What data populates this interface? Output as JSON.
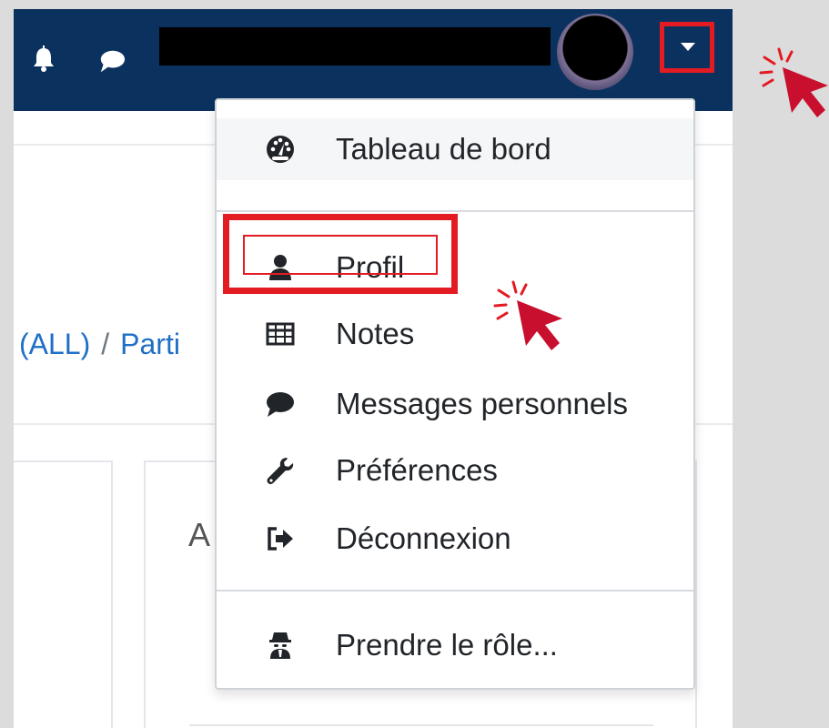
{
  "colors": {
    "navbar": "#0b325f",
    "highlight": "#e31b23",
    "link": "#1f6fc5",
    "text": "#212529"
  },
  "navbar": {
    "icons": [
      "bell-icon",
      "chat-icon"
    ],
    "user_name": "",
    "toggle_icon": "caret-down-icon"
  },
  "breadcrumb": {
    "first": "(ALL)",
    "separator": "/",
    "second": "Parti"
  },
  "block": {
    "heading": "A"
  },
  "user_menu": {
    "items": [
      {
        "label": "Tableau de bord",
        "icon": "dashboard-icon"
      },
      {
        "label": "Profil",
        "icon": "user-icon"
      },
      {
        "label": "Notes",
        "icon": "table-icon"
      },
      {
        "label": "Messages personnels",
        "icon": "comment-icon"
      },
      {
        "label": "Préférences",
        "icon": "wrench-icon"
      },
      {
        "label": "Déconnexion",
        "icon": "sign-out-icon"
      },
      {
        "label": "Prendre le rôle...",
        "icon": "user-secret-icon"
      }
    ]
  }
}
